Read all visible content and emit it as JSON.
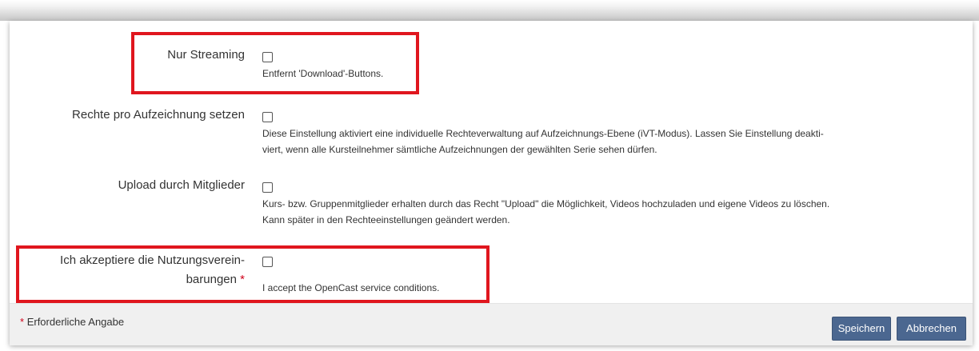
{
  "form": {
    "fields": [
      {
        "label": "Nur Streaming",
        "info": "Entfernt 'Download'-Buttons.",
        "checked": false
      },
      {
        "label": "Rechte pro Aufzeichnung setzen",
        "info_line1": "Diese Einstellung aktiviert eine individuelle Rechteverwaltung auf Aufzeichnungs-Ebene (iVT-Modus). Lassen Sie Einstellung deakti-",
        "info_line2": "viert, wenn alle Kursteilnehmer sämtliche Aufzeichnungen der gewählten Serie sehen dürfen.",
        "checked": false
      },
      {
        "label": "Upload durch Mitglieder",
        "info_line1": "Kurs- bzw. Gruppenmitglieder erhalten durch das Recht \"Upload\" die Möglichkeit, Videos hochzuladen und eigene Videos zu löschen.",
        "info_line2": "Kann später in den Rechteeinstellungen geändert werden.",
        "checked": false
      },
      {
        "label_line1": "Ich akzeptiere die Nutzungsverein-",
        "label_line2": "barungen",
        "required_marker": "*",
        "info": "I accept the OpenCast service conditions.",
        "checked": false
      }
    ]
  },
  "footer": {
    "required_marker": "*",
    "required_note": "Erforderliche Angabe",
    "save_label": "Speichern",
    "cancel_label": "Abbrechen"
  },
  "colors": {
    "highlight": "#e0161e",
    "button": "#4b6790",
    "required": "#d0021b",
    "footer_bg": "#f0f0f0"
  }
}
